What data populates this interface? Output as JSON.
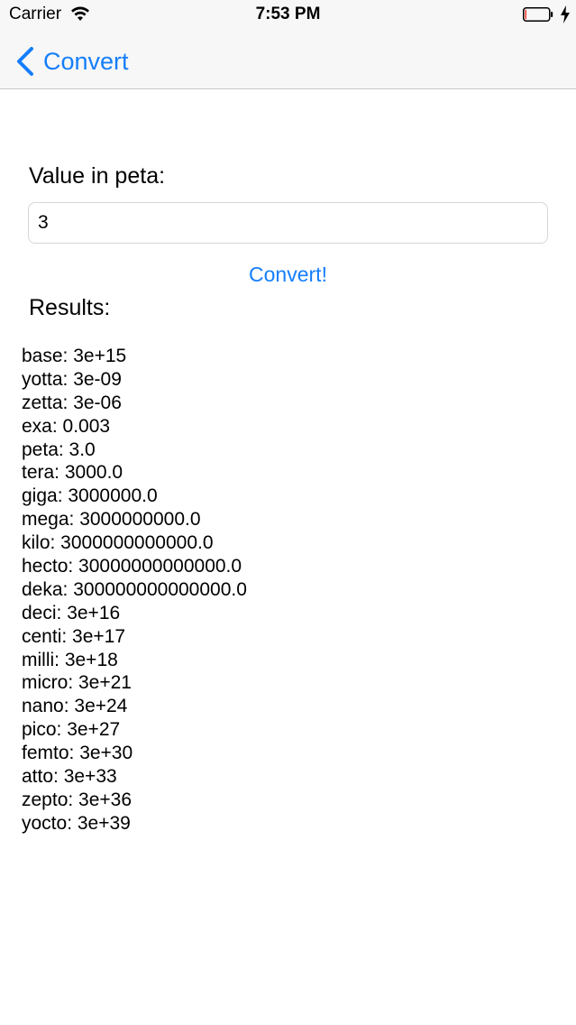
{
  "status_bar": {
    "carrier": "Carrier",
    "time": "7:53 PM",
    "battery_level": 0.05,
    "icons": [
      "wifi-icon",
      "battery-icon",
      "charging-bolt-icon"
    ]
  },
  "nav": {
    "back_label": "Convert",
    "back_icon": "chevron-left-icon"
  },
  "form": {
    "value_label": "Value in peta:",
    "input_value": "3",
    "convert_label": "Convert!"
  },
  "results": {
    "label": "Results:",
    "items": [
      "base: 3e+15",
      "yotta: 3e-09",
      "zetta: 3e-06",
      "exa: 0.003",
      "peta: 3.0",
      "tera: 3000.0",
      "giga: 3000000.0",
      "mega: 3000000000.0",
      "kilo: 3000000000000.0",
      "hecto: 30000000000000.0",
      "deka: 300000000000000.0",
      "deci: 3e+16",
      "centi: 3e+17",
      "milli: 3e+18",
      "micro: 3e+21",
      "nano: 3e+24",
      "pico: 3e+27",
      "femto: 3e+30",
      "atto: 3e+33",
      "zepto: 3e+36",
      "yocto: 3e+39"
    ]
  },
  "colors": {
    "accent": "#157efb",
    "bar_background": "#f7f7f7",
    "battery_low": "#ff3b30"
  }
}
